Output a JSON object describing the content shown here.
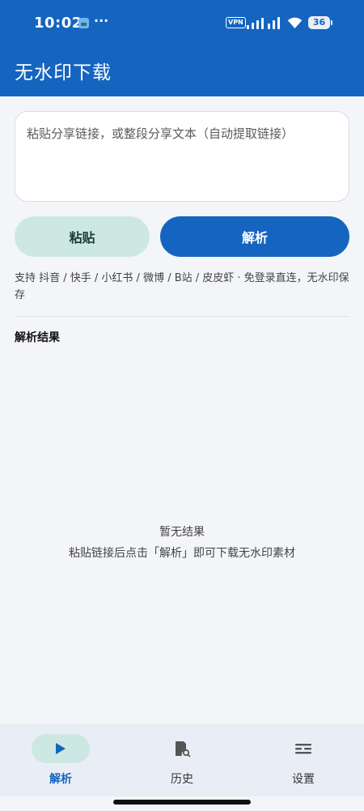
{
  "statusbar": {
    "time": "10:02",
    "more": "···",
    "vpn": "VPN",
    "battery": "36"
  },
  "appbar": {
    "title": "无水印下载"
  },
  "input": {
    "placeholder": "粘贴分享链接，或整段分享文本（自动提取链接）",
    "value": ""
  },
  "buttons": {
    "paste": "粘贴",
    "parse": "解析"
  },
  "support_text": "支持 抖音 / 快手 / 小红书 / 微博 / B站 / 皮皮虾 · 免登录直连，无水印保存",
  "results": {
    "title": "解析结果",
    "empty_title": "暂无结果",
    "empty_hint": "粘贴链接后点击「解析」即可下载无水印素材"
  },
  "nav": {
    "items": [
      {
        "label": "解析",
        "icon": "play-icon",
        "active": true
      },
      {
        "label": "历史",
        "icon": "history-icon",
        "active": false
      },
      {
        "label": "设置",
        "icon": "settings-icon",
        "active": false
      }
    ]
  },
  "colors": {
    "primary": "#1565c0",
    "paste_bg": "#cde8e2",
    "background": "#f3f5f9"
  }
}
